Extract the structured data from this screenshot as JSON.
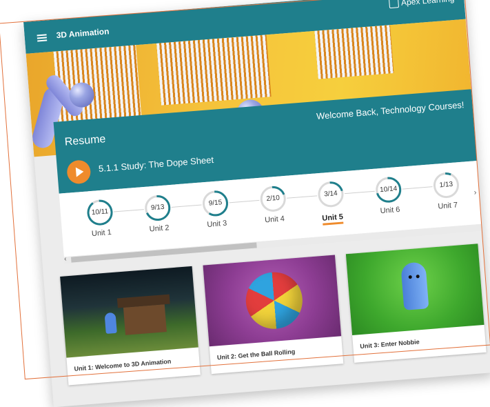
{
  "header": {
    "course_title": "3D Animation",
    "brand": "Apex Learning",
    "menu_icon": "hamburger-menu-icon"
  },
  "resume": {
    "label": "Resume",
    "welcome": "Welcome Back, Technology Courses!",
    "lesson": "5.1.1 Study: The Dope Sheet",
    "play_icon": "play-icon"
  },
  "units": [
    {
      "progress": "10/11",
      "label": "Unit 1",
      "fraction": 0.909,
      "active": false
    },
    {
      "progress": "9/13",
      "label": "Unit 2",
      "fraction": 0.692,
      "active": false
    },
    {
      "progress": "9/15",
      "label": "Unit 3",
      "fraction": 0.6,
      "active": false
    },
    {
      "progress": "2/10",
      "label": "Unit 4",
      "fraction": 0.2,
      "active": false
    },
    {
      "progress": "3/14",
      "label": "Unit 5",
      "fraction": 0.214,
      "active": true
    },
    {
      "progress": "10/14",
      "label": "Unit 6",
      "fraction": 0.714,
      "active": false
    },
    {
      "progress": "1/13",
      "label": "Unit 7",
      "fraction": 0.077,
      "active": false
    }
  ],
  "scroll": {
    "left_arrow": "‹",
    "right_arrow": "›"
  },
  "cards": [
    {
      "title": "Unit 1: Welcome to 3D Animation"
    },
    {
      "title": "Unit 2: Get the Ball Rolling"
    },
    {
      "title": "Unit 3: Enter Nobbie"
    }
  ],
  "colors": {
    "accent": "#1f7f8c",
    "orange": "#ef8b2c",
    "ring_track": "#d9d9d9"
  }
}
